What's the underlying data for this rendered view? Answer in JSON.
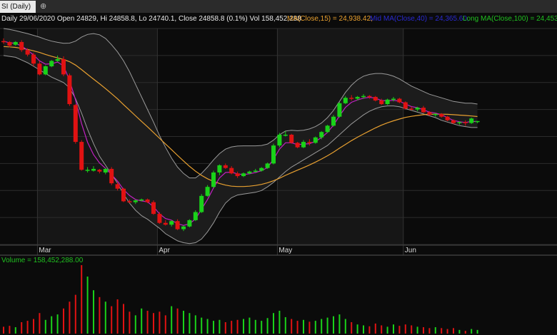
{
  "tab": {
    "title": "SI (Daily)",
    "new_tab_icon": "plus-circle-icon"
  },
  "header": {
    "ohlc": "Daily 29/06/2020 Open 24829, Hi 24858.8, Lo 24740.1, Close 24858.8 (0.1%) Vol 158,452,288",
    "ma15": "MA(Close,15) = 24,938.42,",
    "mid": "Mid MA(Close,40) = 24,365.60,",
    "long": "Long MA(Close,100) = 24,453"
  },
  "volume_label": "Volume = 158,452,288.00",
  "colors": {
    "up": "#19d219",
    "down": "#e01212",
    "ma15": "#e8a030",
    "mid": "#2222cc",
    "long": "#20c020",
    "fast": "#c020c0",
    "band": "#9a9a9a",
    "bg": "#0b0b0b"
  },
  "chart_data": {
    "type": "candlestick",
    "x_labels": [
      "Mar",
      "Apr",
      "May",
      "Jun"
    ],
    "x_label_index": [
      6,
      26,
      46,
      67
    ],
    "ylim": [
      18000,
      30000
    ],
    "candles": [
      [
        29300,
        29450,
        29150,
        29250
      ],
      [
        29250,
        29300,
        28950,
        29050
      ],
      [
        29100,
        29300,
        29050,
        29250
      ],
      [
        29250,
        29350,
        28700,
        28800
      ],
      [
        28800,
        28900,
        28450,
        28550
      ],
      [
        28550,
        28650,
        27900,
        28050
      ],
      [
        28050,
        28200,
        27400,
        27450
      ],
      [
        27450,
        27950,
        27400,
        27900
      ],
      [
        27900,
        28250,
        27850,
        28200
      ],
      [
        28200,
        28500,
        28150,
        28300
      ],
      [
        28300,
        28450,
        27350,
        27450
      ],
      [
        27400,
        27500,
        25700,
        25800
      ],
      [
        25750,
        25800,
        23600,
        23700
      ],
      [
        23700,
        23800,
        22100,
        22150
      ],
      [
        22150,
        22300,
        22000,
        22150
      ],
      [
        22100,
        22350,
        22050,
        22200
      ],
      [
        22150,
        22200,
        21950,
        22050
      ],
      [
        22000,
        22250,
        21900,
        22200
      ],
      [
        22200,
        22300,
        21300,
        21400
      ],
      [
        21350,
        21450,
        21000,
        21100
      ],
      [
        21100,
        21150,
        20350,
        20400
      ],
      [
        20400,
        20500,
        20300,
        20350
      ],
      [
        20350,
        20500,
        20250,
        20450
      ],
      [
        20450,
        20550,
        20400,
        20500
      ],
      [
        20500,
        20550,
        20300,
        20350
      ],
      [
        20350,
        20450,
        19650,
        19700
      ],
      [
        19700,
        19800,
        19150,
        19200
      ],
      [
        19200,
        19350,
        19050,
        19100
      ],
      [
        19100,
        19350,
        19000,
        19300
      ],
      [
        19300,
        19400,
        18800,
        18850
      ],
      [
        18850,
        19050,
        18750,
        19000
      ],
      [
        19000,
        19400,
        18950,
        19350
      ],
      [
        19350,
        19900,
        19300,
        19800
      ],
      [
        19800,
        20800,
        19750,
        20700
      ],
      [
        20700,
        21300,
        20650,
        21200
      ],
      [
        21200,
        22100,
        21150,
        22000
      ],
      [
        22000,
        22450,
        21850,
        22400
      ],
      [
        22400,
        22500,
        22200,
        22250
      ],
      [
        22250,
        22350,
        21900,
        21950
      ],
      [
        21950,
        22050,
        21700,
        21800
      ],
      [
        21800,
        22000,
        21750,
        21950
      ],
      [
        21950,
        22100,
        21900,
        22050
      ],
      [
        22050,
        22200,
        22000,
        22100
      ],
      [
        22100,
        22300,
        22050,
        22250
      ],
      [
        22250,
        22550,
        22200,
        22500
      ],
      [
        22500,
        23600,
        22450,
        23500
      ],
      [
        23500,
        24200,
        23400,
        24100
      ],
      [
        24100,
        24300,
        24000,
        24100
      ],
      [
        24100,
        24150,
        23600,
        23650
      ],
      [
        23650,
        23700,
        23350,
        23400
      ],
      [
        23400,
        23800,
        23350,
        23700
      ],
      [
        23700,
        23850,
        23500,
        23650
      ],
      [
        23650,
        24000,
        23600,
        23950
      ],
      [
        23950,
        24300,
        23850,
        24250
      ],
      [
        24250,
        24650,
        24200,
        24600
      ],
      [
        24600,
        25200,
        24550,
        25100
      ],
      [
        25100,
        25900,
        25050,
        25850
      ],
      [
        25850,
        26250,
        25800,
        26150
      ],
      [
        26150,
        26300,
        26000,
        26100
      ],
      [
        26100,
        26250,
        26000,
        26200
      ],
      [
        26200,
        26350,
        26100,
        26250
      ],
      [
        26250,
        26300,
        26100,
        26200
      ],
      [
        26200,
        26250,
        25950,
        26000
      ],
      [
        26000,
        26100,
        25750,
        25800
      ],
      [
        25800,
        26100,
        25750,
        26050
      ],
      [
        26050,
        26200,
        25950,
        26100
      ],
      [
        26100,
        26150,
        25850,
        25900
      ],
      [
        25900,
        25950,
        25500,
        25550
      ],
      [
        25550,
        25650,
        25450,
        25500
      ],
      [
        25500,
        25650,
        25400,
        25600
      ],
      [
        25600,
        25700,
        25300,
        25350
      ],
      [
        25350,
        25400,
        25150,
        25200
      ],
      [
        25200,
        25300,
        25100,
        25250
      ],
      [
        25250,
        25300,
        25050,
        25100
      ],
      [
        25100,
        25150,
        24850,
        24900
      ],
      [
        24900,
        24950,
        24700,
        24750
      ],
      [
        24750,
        24850,
        24650,
        24800
      ],
      [
        24800,
        24900,
        24600,
        24750
      ],
      [
        24750,
        25050,
        24700,
        25000
      ],
      [
        24829,
        24858.8,
        24740.1,
        24858.8
      ]
    ],
    "volume": [
      15,
      17,
      14,
      25,
      28,
      32,
      45,
      30,
      38,
      42,
      55,
      70,
      85,
      150,
      125,
      95,
      80,
      70,
      60,
      75,
      65,
      48,
      40,
      55,
      50,
      45,
      48,
      40,
      60,
      55,
      50,
      45,
      40,
      35,
      32,
      28,
      30,
      25,
      28,
      30,
      32,
      35,
      30,
      28,
      34,
      45,
      50,
      36,
      32,
      28,
      30,
      26,
      28,
      32,
      35,
      38,
      42,
      32,
      25,
      20,
      18,
      16,
      22,
      18,
      15,
      20,
      17,
      20,
      18,
      15,
      14,
      12,
      14,
      12,
      10,
      12,
      8,
      6,
      10,
      8
    ],
    "ma15": [
      29300,
      29220,
      29150,
      29050,
      28930,
      28790,
      28640,
      28500,
      28400,
      28320,
      28230,
      28090,
      27800,
      27420,
      27050,
      26720,
      26400,
      26090,
      25800,
      25500,
      25130,
      24820,
      24450,
      24120,
      23800,
      23450,
      23080,
      22740,
      22420,
      22080,
      21730,
      21410,
      21120,
      20870,
      20680,
      20530,
      20450,
      20390,
      20350,
      20360,
      20380,
      20420,
      20490,
      20590,
      20730,
      20890,
      21090,
      21300,
      21490,
      21660,
      21810,
      21960,
      22130,
      22320,
      22530,
      22760,
      23010,
      23260,
      23500,
      23730,
      23930,
      24110,
      24300,
      24470,
      24610,
      24740,
      24860,
      24960,
      25030,
      25090,
      25140,
      25170,
      25190,
      25190,
      25170,
      25140,
      25110,
      25070,
      25040,
      25000
    ],
    "mid": [
      29000,
      28980,
      28950,
      28900,
      28840,
      28760,
      28670,
      28560,
      28460,
      28370,
      28280,
      28160,
      27970,
      27720,
      27450,
      27190,
      26930,
      26660,
      26380,
      26090,
      25770,
      25460,
      25150,
      24840,
      24540,
      24220,
      23900,
      23580,
      23270,
      22950,
      22640,
      22340,
      22070,
      21840,
      21650,
      21500,
      21390,
      21300,
      21240,
      21220,
      21220,
      21240,
      21280,
      21340,
      21430,
      21540,
      21680,
      21840,
      21990,
      22130,
      22270,
      22420,
      22580,
      22750,
      22930,
      23130,
      23350,
      23560,
      23770,
      23960,
      24140,
      24310,
      24480,
      24630,
      24760,
      24870,
      24970,
      25060,
      25120,
      25170,
      25210,
      25230,
      25240,
      25240,
      25230,
      25210,
      25190,
      25170,
      25140,
      25110
    ],
    "fast": [
      29300,
      29200,
      29180,
      29020,
      28800,
      28530,
      28200,
      28020,
      28040,
      28140,
      27920,
      27120,
      26030,
      24720,
      23680,
      22990,
      22530,
      22230,
      21880,
      21520,
      21050,
      20720,
      20500,
      20420,
      20370,
      20100,
      19700,
      19440,
      19350,
      19150,
      19060,
      19150,
      19420,
      19960,
      20500,
      21140,
      21700,
      22000,
      22020,
      21920,
      21880,
      21930,
      22000,
      22100,
      22270,
      22740,
      23300,
      23650,
      23650,
      23550,
      23580,
      23600,
      23730,
      23940,
      24230,
      24630,
      25150,
      25620,
      25900,
      26030,
      26130,
      26180,
      26130,
      26000,
      25980,
      26010,
      25960,
      25800,
      25660,
      25600,
      25480,
      25350,
      25300,
      25210,
      25050,
      24890,
      24820,
      24780,
      24840,
      24830
    ],
    "bb_upper": [
      30000,
      29950,
      29880,
      29800,
      29720,
      29620,
      29520,
      29400,
      29300,
      29230,
      29180,
      29190,
      29300,
      29520,
      29670,
      29720,
      29650,
      29450,
      29100,
      28700,
      28200,
      27600,
      26900,
      26200,
      25500,
      24800,
      24050,
      23400,
      22800,
      22300,
      21950,
      21700,
      21700,
      21950,
      22300,
      22700,
      23050,
      23300,
      23420,
      23470,
      23480,
      23480,
      23480,
      23500,
      23580,
      23800,
      24100,
      24300,
      24350,
      24320,
      24350,
      24420,
      24550,
      24750,
      25050,
      25450,
      25950,
      26450,
      26850,
      27150,
      27350,
      27450,
      27500,
      27500,
      27450,
      27350,
      27200,
      27000,
      26800,
      26650,
      26500,
      26350,
      26250,
      26150,
      26050,
      25950,
      25900,
      25850,
      25850,
      25800
    ],
    "bb_lower": [
      28500,
      28450,
      28400,
      28250,
      28100,
      27900,
      27700,
      27500,
      27300,
      27150,
      27000,
      26700,
      26100,
      25300,
      24400,
      23600,
      22900,
      22400,
      21900,
      21400,
      20800,
      20300,
      19900,
      19600,
      19400,
      19150,
      18900,
      18600,
      18400,
      18200,
      18100,
      18050,
      18100,
      18300,
      18700,
      19200,
      19800,
      20300,
      20600,
      20750,
      20800,
      20850,
      20900,
      21000,
      21200,
      21450,
      21750,
      22050,
      22300,
      22500,
      22700,
      22900,
      23100,
      23300,
      23500,
      23800,
      24100,
      24400,
      24700,
      24950,
      25200,
      25400,
      25550,
      25650,
      25700,
      25700,
      25650,
      25550,
      25450,
      25350,
      25250,
      25150,
      25050,
      24900,
      24800,
      24700,
      24600,
      24550,
      24500,
      24500
    ]
  }
}
